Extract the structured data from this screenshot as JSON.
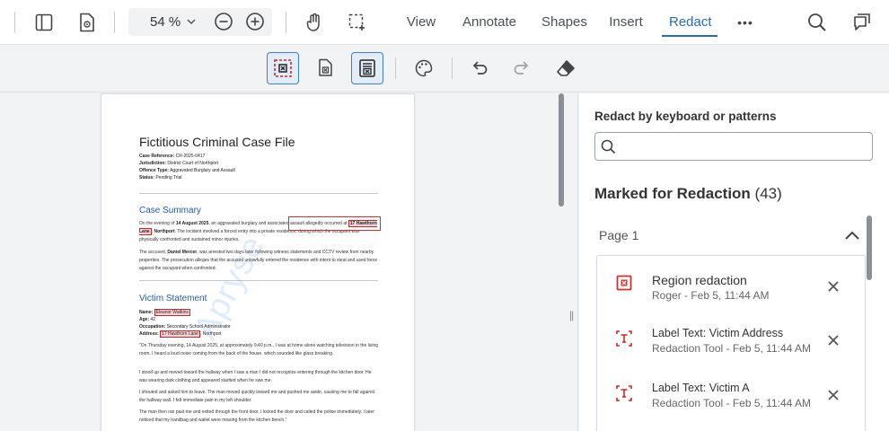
{
  "toolbar": {
    "zoom_value": "54 %",
    "tabs": [
      "View",
      "Annotate",
      "Shapes",
      "Insert",
      "Redact"
    ],
    "active_tab": "Redact",
    "more_label": "•••"
  },
  "document": {
    "title": "Fictitious Criminal Case File",
    "meta": [
      {
        "label": "Case Reference:",
        "value": "CR-2025-0417"
      },
      {
        "label": "Jurisdiction:",
        "value": "District Court of Northport"
      },
      {
        "label": "Offence Type:",
        "value": "Aggravated Burglary and Assault"
      },
      {
        "label": "Status:",
        "value": "Pending Trial"
      }
    ],
    "case_summary_heading": "Case Summary",
    "summary_p1_a": "On the evening of ",
    "summary_p1_date": "14 August 2025",
    "summary_p1_b": ", an aggravated burglary and ",
    "summary_p1_c": "associated assault allegedly occurred",
    "summary_p1_d": " at ",
    "summary_p1_addr": "17 Hawthorn Lane",
    "summary_p1_e": ", ",
    "summary_p1_town": "Northport",
    "summary_p1_f": ". The incident involved a forced entry into a private residence, during which the occupant was physically confronted and sustained minor injuries.",
    "summary_p2_a": "The accused, ",
    "summary_p2_name": "Daniel Mercer",
    "summary_p2_b": ", was arrested two days later following witness statements and CCTV review from nearby properties. The prosecution alleges that the accused unlawfully entered the residence with intent to steal and used force against the occupant when confronted.",
    "victim_heading": "Victim Statement",
    "victim_name_label": "Name:",
    "victim_name": "Eleanor Watkins",
    "victim_age_label": "Age:",
    "victim_age": "42",
    "victim_occ_label": "Occupation:",
    "victim_occ": "Secondary School Administrator",
    "victim_addr_label": "Address:",
    "victim_addr": "17 Hawthorn Lane",
    "victim_addr_town": ", Northport",
    "stmt_p1": "\"On Thursday evening, 14 August 2025, at approximately 9:40 p.m., I was at home alone watching television in the living room. I heard a loud noise coming from the back of the house, which sounded like glass breaking.",
    "stmt_p2": "I stood up and moved toward the hallway when I saw a man I did not recognize entering through the kitchen door. He was wearing dark clothing and appeared startled when he saw me.",
    "stmt_p3": "I shouted and asked him to leave. The man moved quickly toward me and pushed me aside, causing me to fall against the hallway wall. I felt immediate pain in my left shoulder.",
    "stmt_p4": "The man then ran past me and exited through the front door. I locked the door and called the police immediately. I later noticed that my handbag and wallet were missing from the kitchen bench.\"",
    "watermark": "Apryse"
  },
  "panel": {
    "heading": "Redact by keyboard or patterns",
    "search_placeholder": "",
    "marked_title": "Marked for Redaction",
    "marked_count": "(43)",
    "page_label": "Page 1",
    "items": [
      {
        "title": "Region redaction",
        "sub": "Roger - Feb 5, 11:44 AM",
        "icon": "region-redaction-icon"
      },
      {
        "title": "Label Text: Victim Address",
        "sub": "Redaction Tool - Feb 5, 11:44 AM",
        "icon": "text-redaction-icon"
      },
      {
        "title": "Label Text: Victim A",
        "sub": "Redaction Tool - Feb 5, 11:44 AM",
        "icon": "text-redaction-icon"
      }
    ]
  },
  "colors": {
    "accent": "#2a6bb5",
    "redact_red": "#c62828",
    "heading_blue": "#2c5aa0"
  }
}
